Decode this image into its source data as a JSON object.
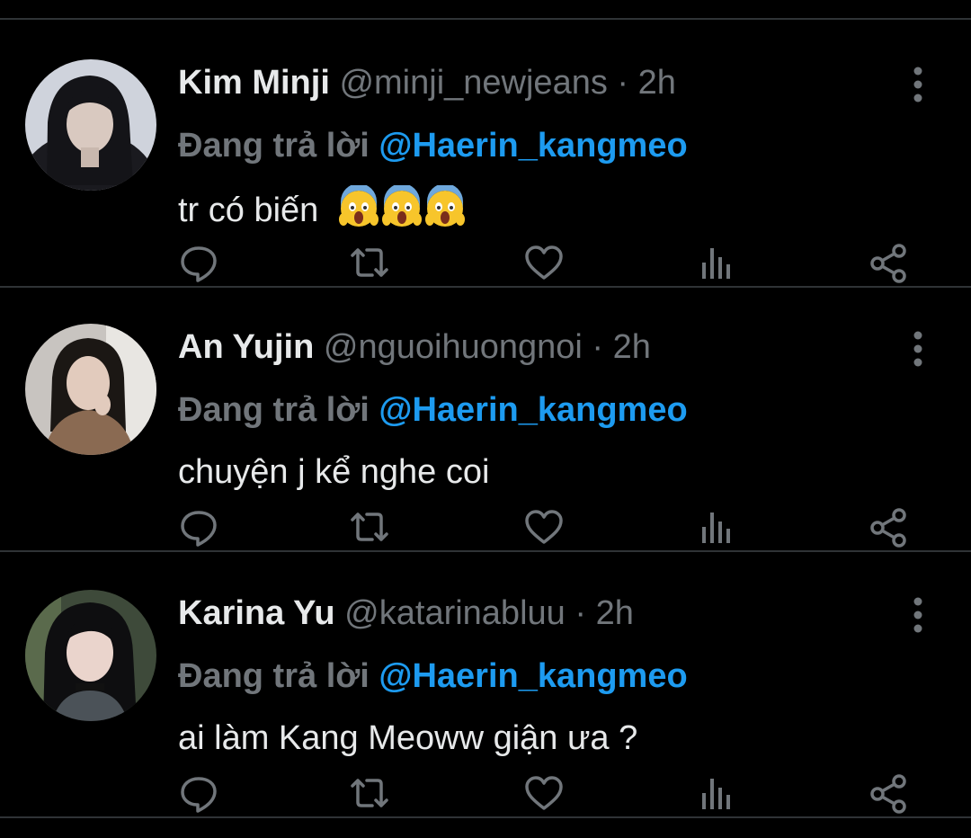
{
  "tweets": [
    {
      "name": "Kim Minji",
      "handle": "@minji_newjeans",
      "dot": "·",
      "time": "2h",
      "reply_prefix": "Đang trả lời",
      "reply_to": "@Haerin_kangmeo",
      "text": "tr có biến",
      "emoji": "face-screaming-in-fear",
      "emoji_count": 3,
      "avatar": "Kim Minji avatar"
    },
    {
      "name": "An Yujin",
      "handle": "@nguoihuongnoi",
      "dot": "·",
      "time": "2h",
      "reply_prefix": "Đang trả lời",
      "reply_to": "@Haerin_kangmeo",
      "text": "chuyện j kể nghe coi",
      "avatar": "An Yujin avatar"
    },
    {
      "name": "Karina Yu",
      "handle": "@katarinabluu",
      "dot": "·",
      "time": "2h",
      "reply_prefix": "Đang trả lời",
      "reply_to": "@Haerin_kangmeo",
      "text": "ai làm Kang Meoww giận ưa ?",
      "avatar": "Karina Yu avatar"
    }
  ],
  "icons": {
    "reply": "reply-icon",
    "retweet": "retweet-icon",
    "like": "heart-icon",
    "views": "views-icon",
    "share": "share-icon",
    "more": "more-vertical-icon"
  },
  "colors": {
    "background": "#000000",
    "divider": "#2f3336",
    "primary_text": "#e7e9ea",
    "secondary_text": "#71767b",
    "mention": "#1d9bf0",
    "icon": "#71767b"
  }
}
